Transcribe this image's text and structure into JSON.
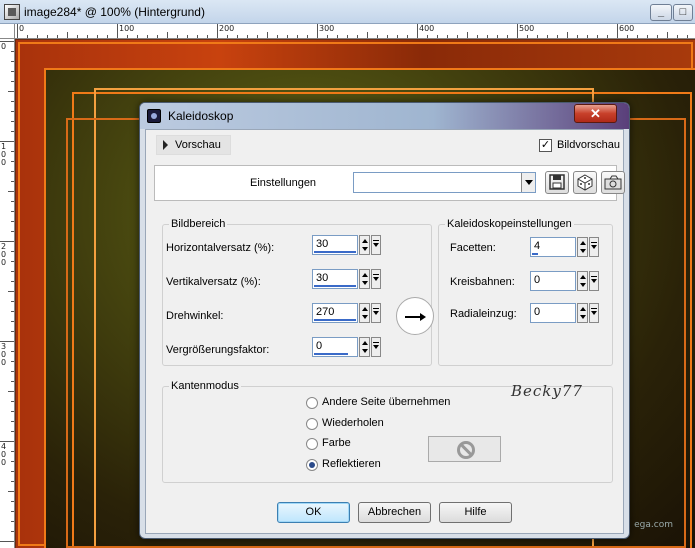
{
  "document": {
    "title": "image284* @ 100% (Hintergrund)",
    "buttons": {
      "minimize": "_",
      "maximize": "□"
    }
  },
  "ruler": {
    "top_labels": [
      "0",
      "100",
      "200",
      "300",
      "400",
      "500",
      "600"
    ],
    "left_labels": [
      "0",
      "100",
      "200",
      "300",
      "400"
    ]
  },
  "dialog": {
    "title": "Kaleidoskop",
    "close": "✕",
    "preview_label": "Vorschau",
    "bildvorschau": {
      "label": "Bildvorschau",
      "checked": true
    },
    "einstellungen": {
      "label": "Einstellungen",
      "value": ""
    },
    "bildbereich": {
      "title": "Bildbereich",
      "fields": [
        {
          "label": "Horizontalversatz (%):",
          "value": "30"
        },
        {
          "label": "Vertikalversatz (%):",
          "value": "30"
        },
        {
          "label": "Drehwinkel:",
          "value": "270"
        },
        {
          "label": "Vergrößerungsfaktor:",
          "value": "0"
        }
      ]
    },
    "kaleido": {
      "title": "Kaleidoskopeinstellungen",
      "fields": [
        {
          "label": "Facetten:",
          "value": "4"
        },
        {
          "label": "Kreisbahnen:",
          "value": "0"
        },
        {
          "label": "Radialeinzug:",
          "value": "0"
        }
      ]
    },
    "kantenmodus": {
      "title": "Kantenmodus",
      "options": [
        {
          "label": "Andere Seite übernehmen",
          "selected": false
        },
        {
          "label": "Wiederholen",
          "selected": false
        },
        {
          "label": "Farbe",
          "selected": false
        },
        {
          "label": "Reflektieren",
          "selected": true
        }
      ]
    },
    "signature": "Becky77",
    "buttons": {
      "ok": "OK",
      "cancel": "Abbrechen",
      "help": "Hilfe"
    }
  },
  "canvas_text": "ega.com"
}
